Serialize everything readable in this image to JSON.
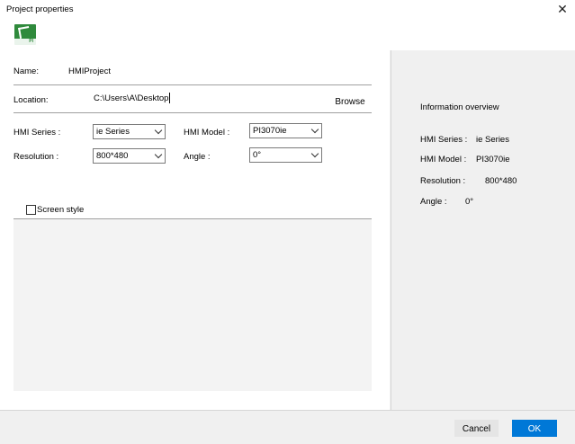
{
  "window": {
    "title": "Project properties",
    "close_glyph": "✕"
  },
  "header": {
    "icon": "hmi-project-icon",
    "icon_caption": "PI"
  },
  "form": {
    "name_label": "Name:",
    "name_value": "HMIProject",
    "location_label": "Location:",
    "location_value": "C:\\Users\\A\\Desktop",
    "browse_label": "Browse",
    "hmi_series_label": "HMI Series :",
    "hmi_series_value": "ie Series",
    "hmi_model_label": "HMI Model :",
    "hmi_model_value": "PI3070ie",
    "resolution_label": "Resolution :",
    "resolution_value": "800*480",
    "angle_label": "Angle :",
    "angle_value": "0°"
  },
  "screen_style": {
    "label": "Screen style",
    "checked": false
  },
  "info": {
    "title": "Information overview",
    "hmi_series_label": "HMI Series :",
    "hmi_series_value": "ie Series",
    "hmi_model_label": "HMI Model :",
    "hmi_model_value": "PI3070ie",
    "resolution_label": "Resolution :",
    "resolution_value": "800*480",
    "angle_label": "Angle :",
    "angle_value": "0°"
  },
  "buttons": {
    "cancel": "Cancel",
    "ok": "OK"
  },
  "colors": {
    "accent": "#0078d7",
    "icon_green": "#2f8a3c"
  }
}
